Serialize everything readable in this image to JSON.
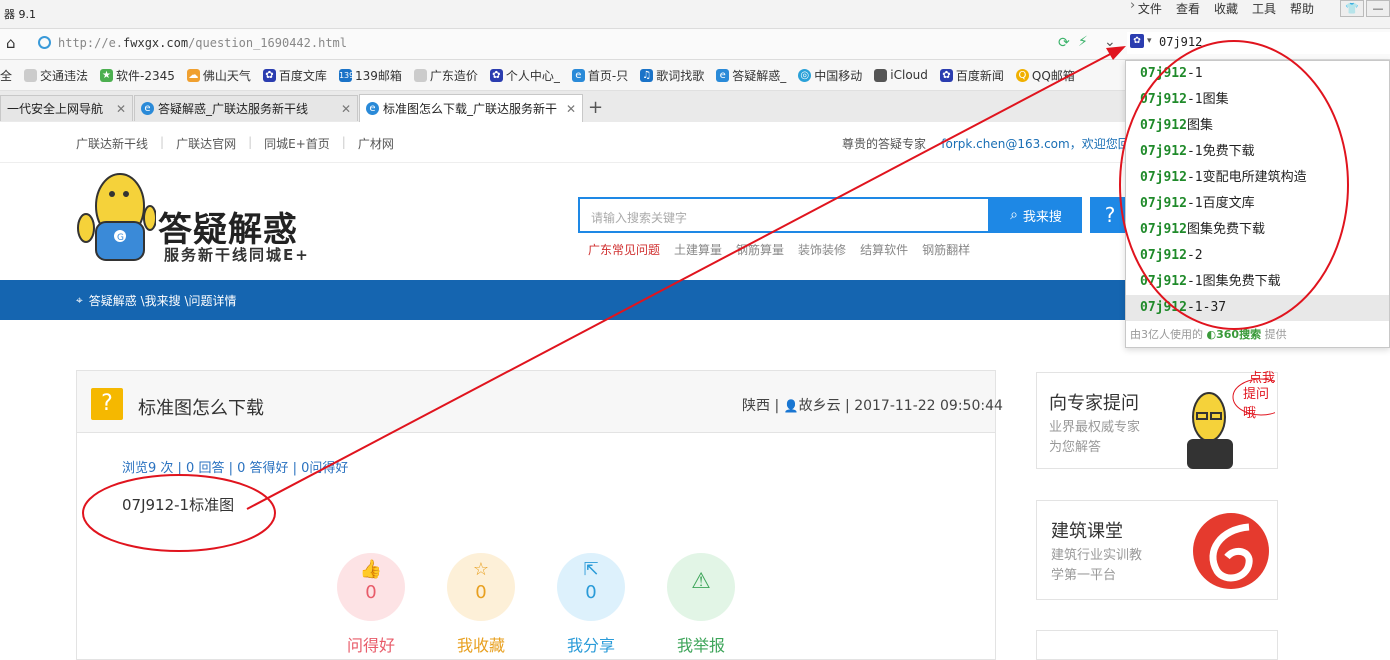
{
  "browser": {
    "title": "器 9.1",
    "menus": [
      "文件",
      "查看",
      "收藏",
      "工具",
      "帮助"
    ],
    "url_prefix": "http://e.",
    "url_domain": "fwxgx.com",
    "url_path": "/question_1690442.html",
    "search_value": "07j912",
    "favorites": [
      "全",
      "交通违法",
      "软件-2345",
      "佛山天气",
      "百度文库",
      "139邮箱",
      "广东造价",
      "个人中心_",
      "首页-只",
      "歌词找歌",
      "答疑解惑_",
      "中国移动",
      "iCloud",
      "百度新闻",
      "QQ邮箱"
    ],
    "tabs": [
      "一代安全上网导航",
      "答疑解惑_广联达服务新干线",
      "标准图怎么下载_广联达服务新干"
    ]
  },
  "site": {
    "top_links": [
      "广联达新干线",
      "广联达官网",
      "同城E+首页",
      "广材网"
    ],
    "welcome_text": "尊贵的答疑专家",
    "welcome_email": "forpk.chen@163.com，欢迎您回来",
    "logo_title": "答疑解惑",
    "logo_subtitle": "服务新干线同城E+",
    "search_placeholder": "请输入搜索关键字",
    "search_button": "我来搜",
    "ask_button": "?",
    "hot_words": [
      "广东常见问题",
      "土建算量",
      "钢筋算量",
      "装饰装修",
      "结算软件",
      "钢筋翻样"
    ],
    "breadcrumb": "答疑解惑 \\我来搜 \\问题详情"
  },
  "question": {
    "title": "标准图怎么下载",
    "location": "陕西",
    "user": "故乡云",
    "datetime": "2017-11-22 09:50:44",
    "stats": "浏览9 次 | 0 回答 | 0 答得好 | 0问得好",
    "body": "07J912-1标准图",
    "actions": [
      {
        "label": "问得好",
        "count": "0",
        "color": "#e85c6a",
        "bg": "#fde3e5"
      },
      {
        "label": "我收藏",
        "count": "0",
        "color": "#e8a020",
        "bg": "#fdf0d8"
      },
      {
        "label": "我分享",
        "count": "0",
        "color": "#2a9bd8",
        "bg": "#ddf1fc"
      },
      {
        "label": "我举报",
        "count": "",
        "color": "#3ea55a",
        "bg": "#e2f5e6"
      }
    ]
  },
  "sidebar": {
    "expert": {
      "title": "向专家提问",
      "desc1": "业界最权威专家",
      "desc2": "为您解答",
      "bubble1": "点我",
      "bubble2": "提问哦"
    },
    "course": {
      "title": "建筑课堂",
      "desc1": "建筑行业实训教",
      "desc2": "学第一平台"
    }
  },
  "suggestions": {
    "items": [
      {
        "prefix": "07j912",
        "rest": "-1"
      },
      {
        "prefix": "07j912",
        "rest": "-1图集"
      },
      {
        "prefix": "07j912",
        "rest": "图集"
      },
      {
        "prefix": "07j912",
        "rest": "-1免费下载"
      },
      {
        "prefix": "07j912",
        "rest": "-1变配电所建筑构造"
      },
      {
        "prefix": "07j912",
        "rest": "-1百度文库"
      },
      {
        "prefix": "07j912",
        "rest": "图集免费下载"
      },
      {
        "prefix": "07j912",
        "rest": "-2"
      },
      {
        "prefix": "07j912",
        "rest": "-1图集免费下载"
      },
      {
        "prefix": "07j912",
        "rest": "-1-37"
      }
    ],
    "footer_pre": "由3亿人使用的",
    "footer_brand": "360搜索",
    "footer_post": "提供"
  },
  "colors": {
    "primary_blue": "#1565b0",
    "search_blue": "#1e88e5",
    "annotation_red": "#e0141e"
  }
}
